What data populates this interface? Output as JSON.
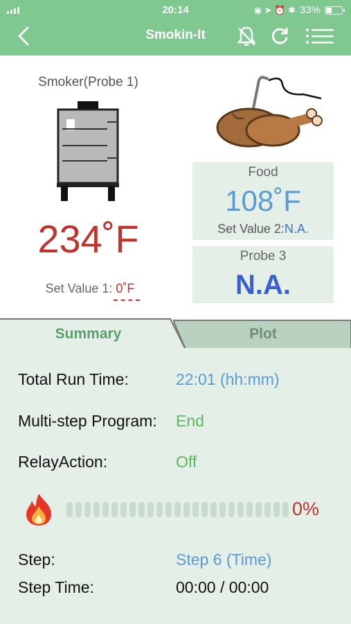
{
  "status_bar": {
    "time": "20:14",
    "battery": "33%"
  },
  "header": {
    "title": "Smokin-It"
  },
  "smoker": {
    "label": "Smoker(Probe 1)",
    "temp": "234˚F",
    "set_label": "Set Value 1: ",
    "set_value": "0˚F"
  },
  "food": {
    "label": "Food",
    "temp": "108˚F",
    "set_label": "Set Value 2:",
    "set_value": "N.A."
  },
  "probe3": {
    "label": "Probe 3",
    "value": "N.A."
  },
  "tabs": [
    {
      "label": "Summary",
      "active": true
    },
    {
      "label": "Plot",
      "active": false
    }
  ],
  "summary": {
    "total_run_time_label": "Total Run Time:",
    "total_run_time_value": "22:01 (hh:mm)",
    "program_label": "Multi-step Program:",
    "program_value": "End",
    "relay_label": "RelayAction:",
    "relay_value": "Off",
    "progress_percent": "0%",
    "step_label": "Step:",
    "step_value": "Step 6 (Time)",
    "step_time_label": "Step Time:",
    "step_time_value": "00:00 / 00:00"
  },
  "colors": {
    "header_green": "#7fc88f",
    "panel_green": "#e4efe7",
    "temp_red": "#c0322a",
    "value_blue": "#5a9bd6",
    "value_green": "#5cb85c"
  },
  "icons": [
    "back-icon",
    "bell-muted-icon",
    "refresh-icon",
    "menu-list-icon",
    "smoker-icon",
    "turkey-probe-icon",
    "flame-icon"
  ]
}
